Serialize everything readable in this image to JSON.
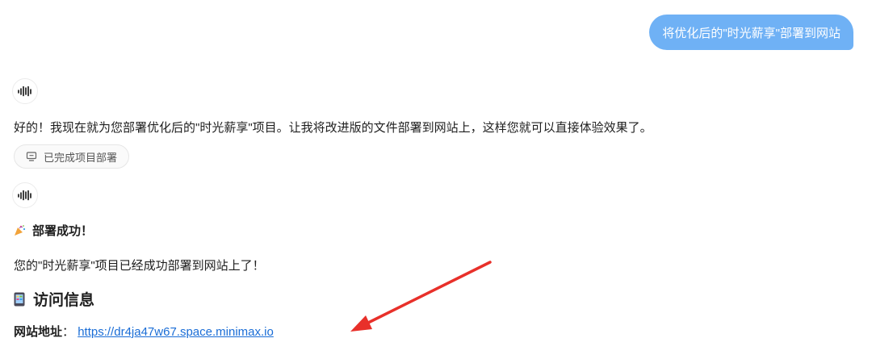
{
  "user_message": "将优化后的\"时光薪享\"部署到网站",
  "reply1": {
    "text": "好的！我现在就为您部署优化后的\"时光薪享\"项目。让我将改进版的文件部署到网站上，这样您就可以直接体验效果了。",
    "status_chip": "已完成项目部署"
  },
  "reply2": {
    "success_heading": "部署成功！",
    "success_text": "您的\"时光薪享\"项目已经成功部署到网站上了！",
    "access_heading": "访问信息",
    "site_label": "网站地址",
    "site_separator": "：",
    "site_url": "https://dr4ja47w67.space.minimax.io"
  },
  "icons": {
    "avatar": "waveform-icon",
    "chip": "monitor-icon",
    "success": "party-popper-icon",
    "access": "mobile-phone-icon"
  },
  "colors": {
    "user_bubble": "#6fb1f5",
    "link": "#1a6dd6",
    "annotation_arrow": "#e8302a"
  }
}
